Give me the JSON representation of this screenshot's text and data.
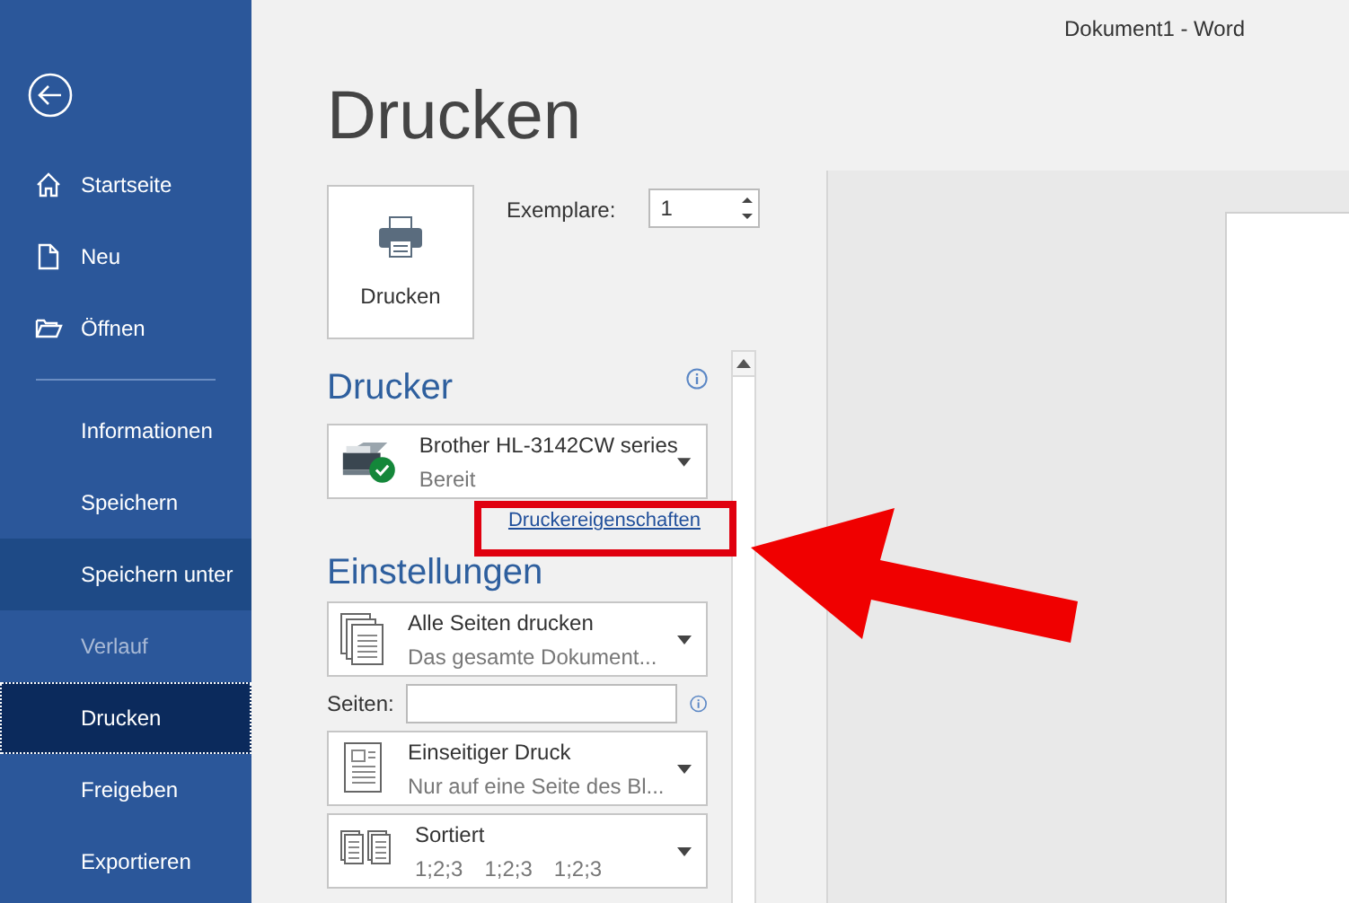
{
  "window": {
    "title": "Dokument1 - Word"
  },
  "sidebar": {
    "top_items": [
      {
        "label": "Startseite",
        "kind": "home",
        "selected": false,
        "hovered": false,
        "disabled": false
      },
      {
        "label": "Neu",
        "kind": "new",
        "selected": false,
        "hovered": false,
        "disabled": false
      },
      {
        "label": "Öffnen",
        "kind": "open",
        "selected": false,
        "hovered": false,
        "disabled": false
      }
    ],
    "items": [
      {
        "label": "Informationen",
        "selected": false,
        "hovered": false,
        "disabled": false
      },
      {
        "label": "Speichern",
        "selected": false,
        "hovered": false,
        "disabled": false
      },
      {
        "label": "Speichern unter",
        "selected": false,
        "hovered": true,
        "disabled": false
      },
      {
        "label": "Verlauf",
        "selected": false,
        "hovered": false,
        "disabled": true
      },
      {
        "label": "Drucken",
        "selected": true,
        "hovered": false,
        "disabled": false
      },
      {
        "label": "Freigeben",
        "selected": false,
        "hovered": false,
        "disabled": false
      },
      {
        "label": "Exportieren",
        "selected": false,
        "hovered": false,
        "disabled": false
      }
    ]
  },
  "heading": "Drucken",
  "print_button": {
    "label": "Drucken"
  },
  "copies": {
    "label": "Exemplare:",
    "value": "1"
  },
  "printer": {
    "heading": "Drucker",
    "name": "Brother HL-3142CW series",
    "status": "Bereit",
    "ready": true,
    "link": "Druckereigenschaften"
  },
  "settings": {
    "heading": "Einstellungen",
    "rows": [
      {
        "kind": "dropdown",
        "title": "Alle Seiten drucken",
        "subtitle": "Das gesamte Dokument..."
      },
      {
        "kind": "field",
        "label": "Seiten:"
      },
      {
        "kind": "dropdown",
        "title": "Einseitiger Druck",
        "subtitle": "Nur auf eine Seite des Bl..."
      },
      {
        "kind": "dropdown",
        "title": "Sortiert",
        "sequences": [
          "1;2;3",
          "1;2;3",
          "1;2;3"
        ]
      }
    ]
  }
}
